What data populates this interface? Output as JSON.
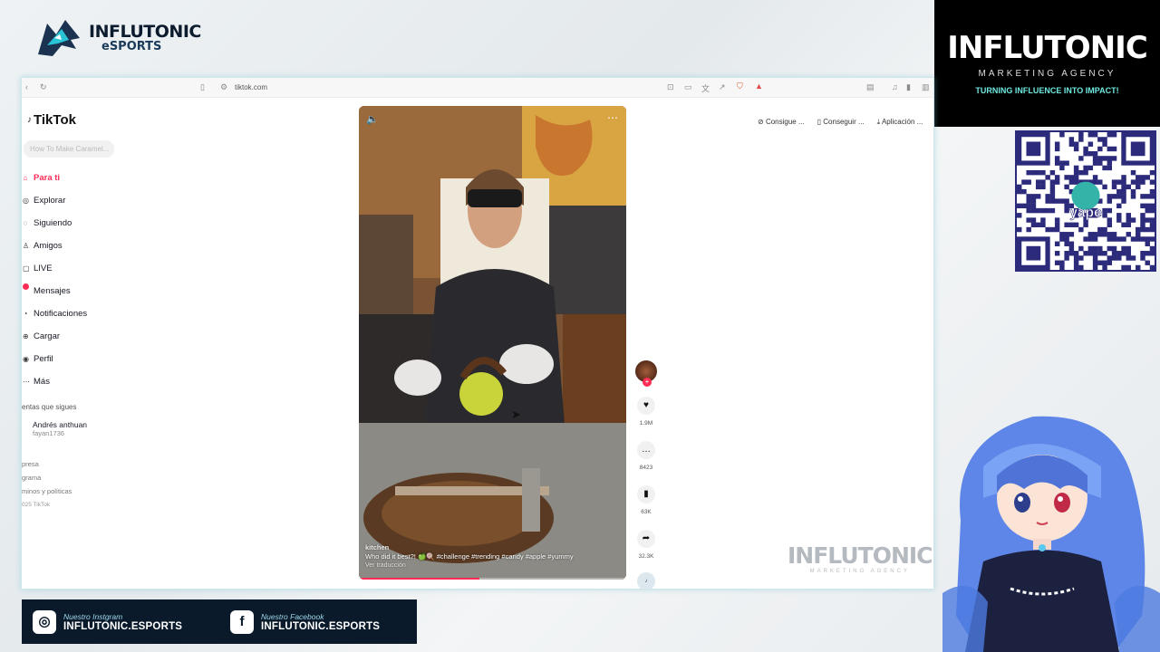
{
  "overlay": {
    "esports_logo": {
      "line1": "INFLUTONIC",
      "line2": "eSPORTS"
    },
    "agency": {
      "name": "INFLUTONIC",
      "sub": "MARKETING AGENCY",
      "tagline": "TURNING INFLUENCE INTO IMPACT!"
    },
    "watermark": {
      "name": "INFLUTONIC",
      "sub": "MARKETING AGENCY"
    },
    "social": [
      {
        "label": "Nuestro Instgram",
        "handle": "INFLUTONIC.ESPORTS",
        "icon": "instagram-icon"
      },
      {
        "label": "Nuestro Facebook",
        "handle": "INFLUTONIC.ESPORTS",
        "icon": "facebook-icon"
      }
    ],
    "qr_badge": "yape"
  },
  "browser": {
    "url": "tiktok.com"
  },
  "tiktok": {
    "brand": "TikTok",
    "search_placeholder": "How To Make Caramel...",
    "nav": [
      {
        "label": "Para ti",
        "active": true
      },
      {
        "label": "Explorar"
      },
      {
        "label": "Siguiendo"
      },
      {
        "label": "Amigos"
      },
      {
        "label": "LIVE"
      },
      {
        "label": "Mensajes"
      },
      {
        "label": "Notificaciones"
      },
      {
        "label": "Cargar"
      },
      {
        "label": "Perfil"
      },
      {
        "label": "Más"
      }
    ],
    "following_title": "entas que sigues",
    "following_user": "Andrés anthuan",
    "following_handle": "fayan1736",
    "footer": [
      "presa",
      "grama",
      "minos y políticas"
    ],
    "copyright": "025 TikTok",
    "top_actions": [
      "Consigue ...",
      "Conseguir ...",
      "Aplicación ..."
    ],
    "video": {
      "author": "kitchen",
      "caption": "Who did it best?! 🍏🍭 #challenge #trending #candy #apple #yummy",
      "translate": "Ver traducción",
      "progress": 0.45
    },
    "counts": {
      "likes": "1.9M",
      "comments": "8423",
      "saves": "63K",
      "shares": "32.3K"
    }
  }
}
